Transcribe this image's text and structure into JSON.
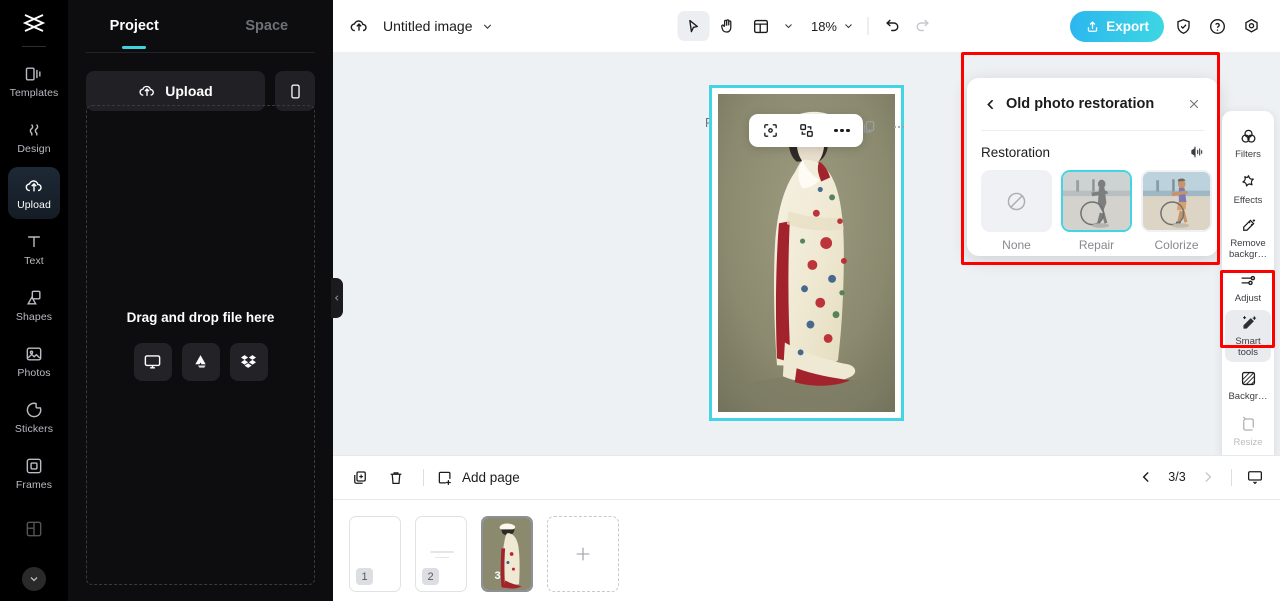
{
  "brand": {
    "logo_name": "capcut-logo"
  },
  "left_rail": {
    "items": [
      {
        "label": "Templates",
        "icon": "templates-icon",
        "active": false
      },
      {
        "label": "Design",
        "icon": "design-icon",
        "active": false
      },
      {
        "label": "Upload",
        "icon": "upload-cloud-icon",
        "active": true
      },
      {
        "label": "Text",
        "icon": "text-icon",
        "active": false
      },
      {
        "label": "Shapes",
        "icon": "shapes-icon",
        "active": false
      },
      {
        "label": "Photos",
        "icon": "photos-icon",
        "active": false
      },
      {
        "label": "Stickers",
        "icon": "stickers-icon",
        "active": false
      },
      {
        "label": "Frames",
        "icon": "frames-icon",
        "active": false
      }
    ],
    "more_icon": "chevron-down-icon"
  },
  "panel": {
    "tabs": [
      {
        "label": "Project",
        "active": true
      },
      {
        "label": "Space",
        "active": false
      }
    ],
    "upload_label": "Upload",
    "upload_icon": "upload-cloud-icon",
    "phone_icon": "mobile-upload-icon",
    "dropzone_text": "Drag and drop file here",
    "sources": [
      {
        "name": "computer-icon"
      },
      {
        "name": "google-drive-icon"
      },
      {
        "name": "dropbox-icon"
      }
    ],
    "collapse_icon": "chevron-left-icon"
  },
  "topbar": {
    "cloud_icon": "cloud-save-icon",
    "doc_title": "Untitled image",
    "doc_caret_icon": "chevron-down-icon",
    "tools": [
      {
        "name": "select-tool",
        "icon": "cursor-arrow-icon",
        "selected": true
      },
      {
        "name": "hand-tool",
        "icon": "hand-icon",
        "selected": false
      },
      {
        "name": "layout-tool",
        "icon": "layout-grid-icon",
        "selected": false
      }
    ],
    "layout_caret_icon": "chevron-down-icon",
    "zoom_level": "18%",
    "zoom_caret_icon": "chevron-down-icon",
    "undo_icon": "undo-icon",
    "redo_icon": "redo-icon",
    "export_label": "Export",
    "export_icon": "share-upload-icon",
    "export_color": "#2bb6ef",
    "shield_icon": "shield-check-icon",
    "help_icon": "help-circle-icon",
    "settings_icon": "settings-gear-icon"
  },
  "canvas": {
    "page_label": "Page 3",
    "selection_color": "#43d4e6",
    "float_tools": [
      {
        "name": "crop-tool",
        "icon": "crop-frame-icon"
      },
      {
        "name": "replace-tool",
        "icon": "swap-replace-icon"
      },
      {
        "name": "more-tool",
        "icon": "more-dots-icon"
      }
    ],
    "side_icons": [
      {
        "name": "duplicate-icon"
      },
      {
        "name": "more-dots-icon"
      }
    ],
    "artwork_alt": "Hand-colored vintage photograph of a woman in a white wedding kimono"
  },
  "restoration_panel": {
    "back_icon": "chevron-left-icon",
    "title": "Old photo restoration",
    "close_icon": "close-icon",
    "section_label": "Restoration",
    "compare_icon": "before-after-compare-icon",
    "options": [
      {
        "label": "None",
        "icon": "no-effect-icon",
        "selected": false
      },
      {
        "label": "Repair",
        "icon": "repair-thumbnail",
        "selected": true
      },
      {
        "label": "Colorize",
        "icon": "colorize-thumbnail",
        "selected": false
      }
    ],
    "highlight_color": "#ff0000"
  },
  "right_rail": {
    "items": [
      {
        "label": "Filters",
        "icon": "filters-icon",
        "active": false,
        "faded": false
      },
      {
        "label": "Effects",
        "icon": "effects-star-icon",
        "active": false,
        "faded": false
      },
      {
        "label": "Remove backgr…",
        "icon": "remove-background-icon",
        "active": false,
        "faded": false
      },
      {
        "label": "Adjust",
        "icon": "adjust-sliders-icon",
        "active": false,
        "faded": false
      },
      {
        "label": "Smart tools",
        "icon": "smart-tools-wand-icon",
        "active": true,
        "faded": false
      },
      {
        "label": "Backgr…",
        "icon": "background-icon",
        "active": false,
        "faded": false
      },
      {
        "label": "Resize",
        "icon": "resize-icon",
        "active": false,
        "faded": true
      }
    ]
  },
  "bottom_bar": {
    "duplicate_icon": "duplicate-page-icon",
    "delete_icon": "trash-icon",
    "add_page_label": "Add page",
    "add_page_icon": "add-page-icon",
    "prev_icon": "chevron-left-icon",
    "next_icon": "chevron-right-icon",
    "page_counter": "3/3",
    "view_icon": "presentation-view-icon",
    "thumbnails": [
      {
        "number": "1",
        "active": false,
        "kind": "blank"
      },
      {
        "number": "2",
        "active": false,
        "kind": "lines"
      },
      {
        "number": "3",
        "active": true,
        "kind": "photo"
      }
    ],
    "add_thumb_icon": "plus-icon"
  }
}
